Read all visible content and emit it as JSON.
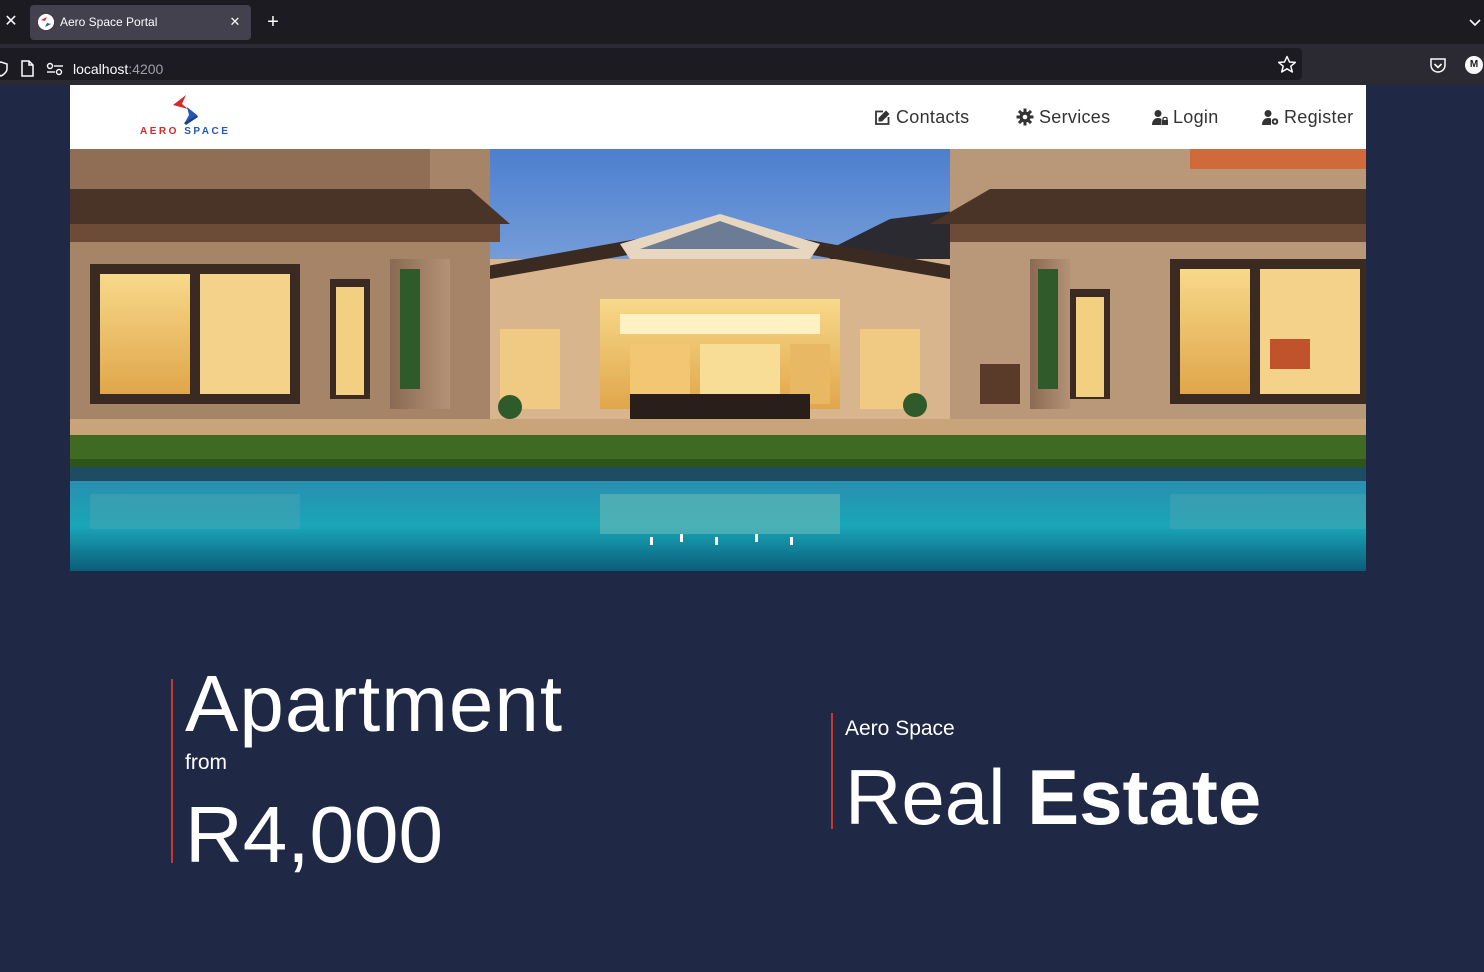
{
  "browser": {
    "tab_title": "Aero Space Portal",
    "url_host": "localhost",
    "url_port": ":4200",
    "account_initial": "M"
  },
  "logo": {
    "word1": "AERO",
    "word2": "SPACE"
  },
  "nav": {
    "contacts": "Contacts",
    "services": "Services",
    "login": "Login",
    "register": "Register"
  },
  "offer": {
    "title": "Apartment",
    "from": "from",
    "price": "R4,000"
  },
  "brand": {
    "small": "Aero Space",
    "word1": "Real",
    "word2": "Estate"
  },
  "colors": {
    "page_bg": "#1f2945",
    "accent_line": "#c8372d",
    "logo_red": "#d42a2a",
    "logo_blue": "#2458b4"
  }
}
